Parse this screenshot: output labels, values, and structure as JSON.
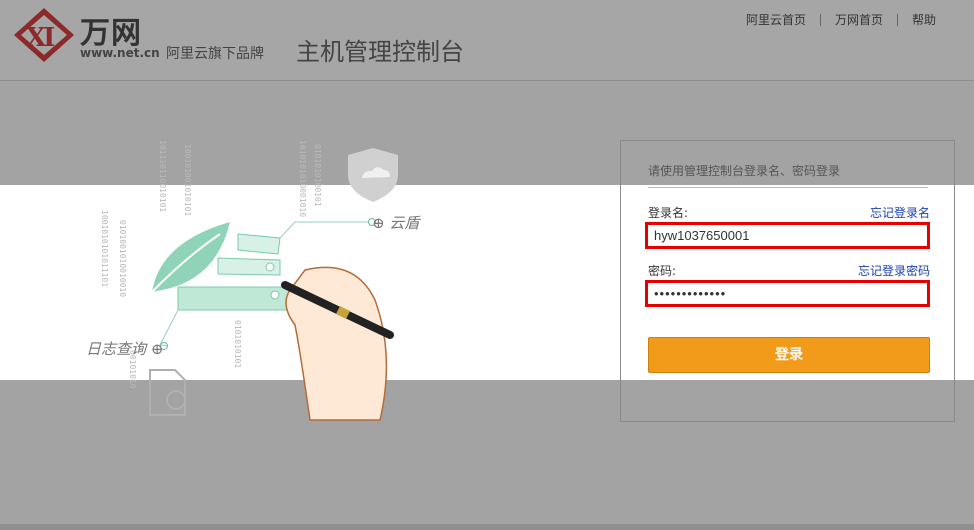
{
  "header": {
    "brand_name": "万网",
    "brand_url": "www.net.cn",
    "brand_sub": "阿里云旗下品牌",
    "console_title": "主机管理控制台",
    "nav": [
      "阿里云首页",
      "万网首页",
      "帮助"
    ]
  },
  "illustration": {
    "tag_cloud": "云盾",
    "tag_log": "日志查询"
  },
  "login": {
    "hint": "请使用管理控制台登录名、密码登录",
    "username_label": "登录名:",
    "forgot_username": "忘记登录名",
    "username_value": "hyw1037650001",
    "password_label": "密码:",
    "forgot_password": "忘记登录密码",
    "password_value": "•••••••••••••",
    "submit_label": "登录"
  },
  "colors": {
    "highlight_border": "#e60000",
    "button": "#f29a1a",
    "link": "#1a3fb3"
  }
}
